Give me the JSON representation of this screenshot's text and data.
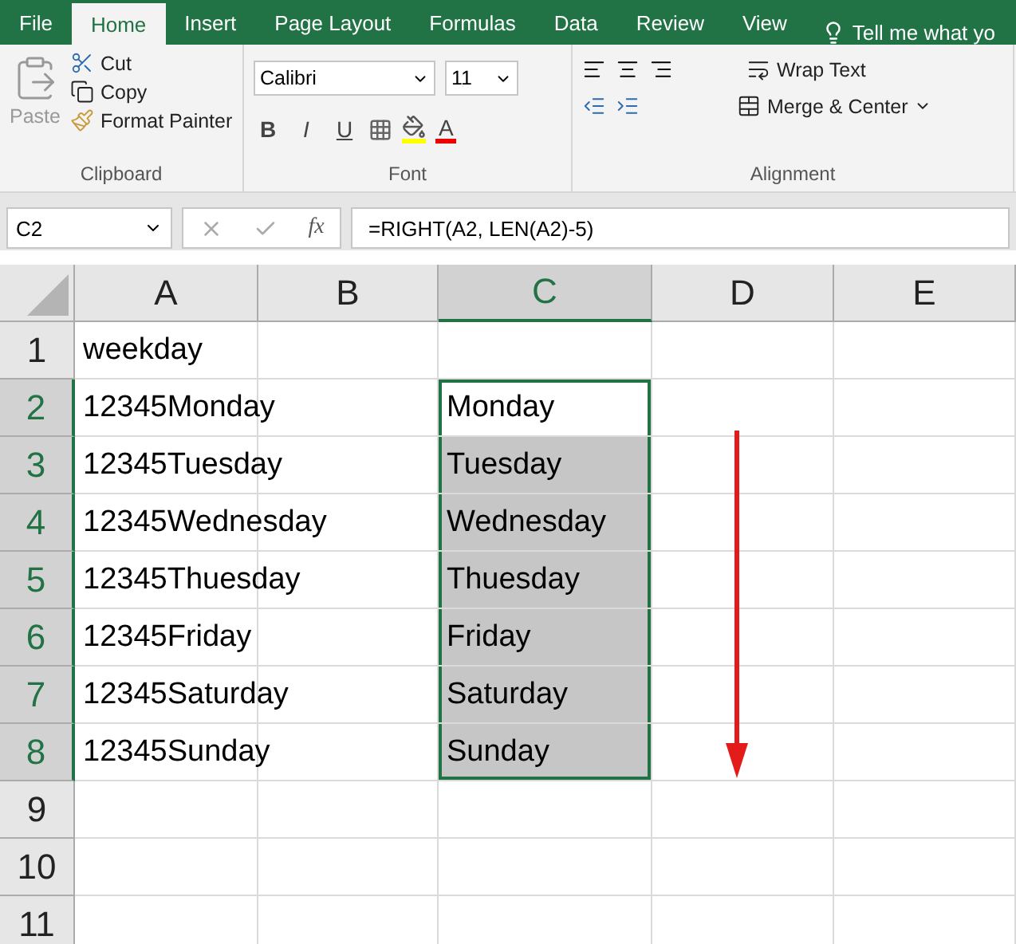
{
  "tabs": [
    {
      "label": "File",
      "selected": false
    },
    {
      "label": "Home",
      "selected": true
    },
    {
      "label": "Insert",
      "selected": false
    },
    {
      "label": "Page Layout",
      "selected": false
    },
    {
      "label": "Formulas",
      "selected": false
    },
    {
      "label": "Data",
      "selected": false
    },
    {
      "label": "Review",
      "selected": false
    },
    {
      "label": "View",
      "selected": false
    }
  ],
  "tell_me": "Tell me what yo",
  "clipboard": {
    "paste": "Paste",
    "cut": "Cut",
    "copy": "Copy",
    "format_painter": "Format Painter",
    "label": "Clipboard"
  },
  "font": {
    "name": "Calibri",
    "size": "11",
    "bold": "B",
    "italic": "I",
    "underline": "U",
    "color_letter": "A",
    "label": "Font"
  },
  "alignment": {
    "wrap": "Wrap Text",
    "merge": "Merge & Center",
    "label": "Alignment"
  },
  "name_box": "C2",
  "fx": "fx",
  "formula": "=RIGHT(A2, LEN(A2)-5)",
  "columns": [
    {
      "label": "A",
      "selected": false
    },
    {
      "label": "B",
      "selected": false
    },
    {
      "label": "C",
      "selected": true
    },
    {
      "label": "D",
      "selected": false
    },
    {
      "label": "E",
      "selected": false
    }
  ],
  "rows": [
    {
      "header": "1",
      "selected": false,
      "cells": [
        "weekday",
        "",
        ""
      ]
    },
    {
      "header": "2",
      "selected": true,
      "cells": [
        "12345Monday",
        "",
        "Monday"
      ]
    },
    {
      "header": "3",
      "selected": true,
      "cells": [
        "12345Tuesday",
        "",
        "Tuesday"
      ]
    },
    {
      "header": "4",
      "selected": true,
      "cells": [
        "12345Wednesday",
        "",
        "Wednesday"
      ]
    },
    {
      "header": "5",
      "selected": true,
      "cells": [
        "12345Thuesday",
        "",
        "Thuesday"
      ]
    },
    {
      "header": "6",
      "selected": true,
      "cells": [
        "12345Friday",
        "",
        "Friday"
      ]
    },
    {
      "header": "7",
      "selected": true,
      "cells": [
        "12345Saturday",
        "",
        "Saturday"
      ]
    },
    {
      "header": "8",
      "selected": true,
      "cells": [
        "12345Sunday",
        "",
        "Sunday"
      ]
    },
    {
      "header": "9",
      "selected": false,
      "cells": [
        "",
        "",
        ""
      ]
    },
    {
      "header": "10",
      "selected": false,
      "cells": [
        "",
        "",
        ""
      ]
    },
    {
      "header": "11",
      "selected": false,
      "cells": [
        "",
        "",
        ""
      ]
    }
  ]
}
